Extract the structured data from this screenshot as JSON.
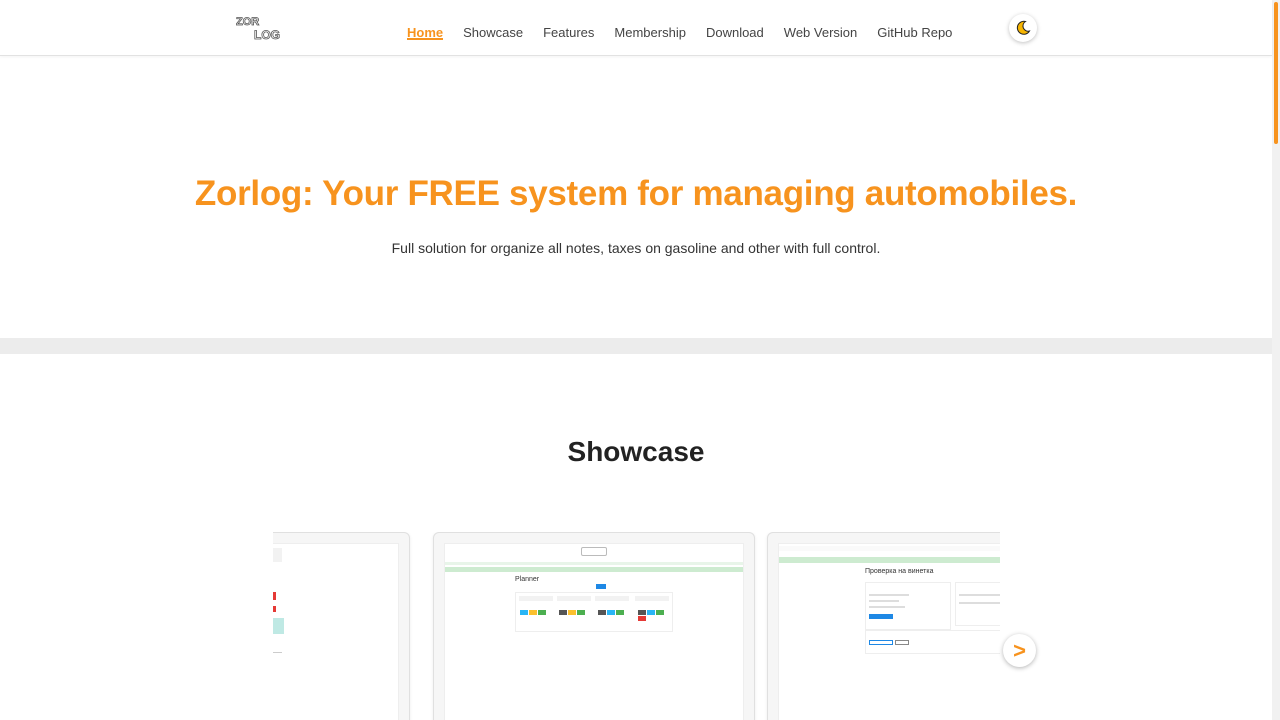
{
  "header": {
    "logo_text": "ZOR LOG",
    "nav": [
      {
        "label": "Home",
        "active": true
      },
      {
        "label": "Showcase"
      },
      {
        "label": "Features"
      },
      {
        "label": "Membership"
      },
      {
        "label": "Download"
      },
      {
        "label": "Web Version"
      },
      {
        "label": "GitHub Repo"
      }
    ],
    "theme_icon": "moon-icon"
  },
  "hero": {
    "title": "Zorlog: Your FREE system for managing automobiles.",
    "subtitle": "Full solution for organize all notes, taxes on gasoline and other with full control."
  },
  "showcase": {
    "title": "Showcase",
    "next_icon": "chevron-right-icon",
    "next_label": ">",
    "cards": [
      {
        "caption": ""
      },
      {
        "caption": "Planner"
      },
      {
        "caption": "Проверка на винетка"
      }
    ]
  },
  "colors": {
    "accent": "#f7931e",
    "page_bg": "#ececec"
  }
}
